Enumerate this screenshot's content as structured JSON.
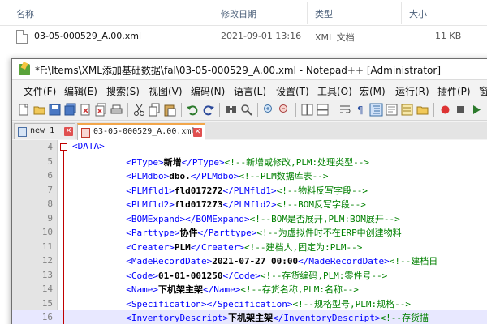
{
  "explorer": {
    "columns": [
      "名称",
      "修改日期",
      "类型",
      "大小"
    ],
    "file": {
      "name": "03-05-000529_A.00.xml",
      "modified": "2021-09-01 13:16",
      "type": "XML 文档",
      "size": "11 KB"
    }
  },
  "window": {
    "title": "*F:\\Items\\XML添加基础数据\\fal\\03-05-000529_A.00.xml - Notepad++ [Administrator]",
    "menu": [
      "文件(F)",
      "编辑(E)",
      "搜索(S)",
      "视图(V)",
      "编码(N)",
      "语言(L)",
      "设置(T)",
      "工具(O)",
      "宏(M)",
      "运行(R)",
      "插件(P)",
      "窗"
    ]
  },
  "tabs": [
    {
      "label": "new 1",
      "active": false
    },
    {
      "label": "03-05-000529_A.00.xml",
      "active": true
    }
  ],
  "editor": {
    "lines": [
      {
        "num": "4",
        "parts": [
          [
            "tag",
            "<DATA>"
          ]
        ]
      },
      {
        "num": "5",
        "parts": [
          [
            "tag",
            "<PType>"
          ],
          [
            "txt",
            "新增"
          ],
          [
            "tag",
            "</PType>"
          ],
          [
            "cmt",
            "<!--新增或修改,PLM:处理类型-->"
          ]
        ]
      },
      {
        "num": "6",
        "parts": [
          [
            "tag",
            "<PLMdbo>"
          ],
          [
            "txt",
            "dbo."
          ],
          [
            "tag",
            "</PLMdbo>"
          ],
          [
            "cmt",
            "<!--PLM数据库表-->"
          ]
        ]
      },
      {
        "num": "7",
        "parts": [
          [
            "tag",
            "<PLMfld1>"
          ],
          [
            "txt",
            "fld017272"
          ],
          [
            "tag",
            "</PLMfld1>"
          ],
          [
            "cmt",
            "<!--物料反写字段-->"
          ]
        ]
      },
      {
        "num": "8",
        "parts": [
          [
            "tag",
            "<PLMfld2>"
          ],
          [
            "txt",
            "fld017273"
          ],
          [
            "tag",
            "</PLMfld2>"
          ],
          [
            "cmt",
            "<!--BOM反写字段-->"
          ]
        ]
      },
      {
        "num": "9",
        "parts": [
          [
            "tag",
            "<BOMExpand>"
          ],
          [
            "tag",
            "</BOMExpand>"
          ],
          [
            "cmt",
            "<!--BOM是否展开,PLM:BOM展开-->"
          ]
        ]
      },
      {
        "num": "10",
        "parts": [
          [
            "tag",
            "<Parttype>"
          ],
          [
            "txt",
            "协件"
          ],
          [
            "tag",
            "</Parttype>"
          ],
          [
            "cmt",
            "<!--为虚拟件时不在ERP中创建物料"
          ]
        ]
      },
      {
        "num": "11",
        "parts": [
          [
            "tag",
            "<Creater>"
          ],
          [
            "txt",
            "PLM"
          ],
          [
            "tag",
            "</Creater>"
          ],
          [
            "cmt",
            "<!--建档人,固定为:PLM-->"
          ]
        ]
      },
      {
        "num": "12",
        "parts": [
          [
            "tag",
            "<MadeRecordDate>"
          ],
          [
            "txt",
            "2021-07-27 00:00"
          ],
          [
            "tag",
            "</MadeRecordDate>"
          ],
          [
            "cmt",
            "<!--建档日"
          ]
        ]
      },
      {
        "num": "13",
        "parts": [
          [
            "tag",
            "<Code>"
          ],
          [
            "txt",
            "01-01-001250"
          ],
          [
            "tag",
            "</Code>"
          ],
          [
            "cmt",
            "<!--存货编码,PLM:零件号-->"
          ]
        ]
      },
      {
        "num": "14",
        "parts": [
          [
            "tag",
            "<Name>"
          ],
          [
            "txt",
            "下机架主架"
          ],
          [
            "tag",
            "</Name>"
          ],
          [
            "cmt",
            "<!--存货名称,PLM:名称-->"
          ]
        ]
      },
      {
        "num": "15",
        "parts": [
          [
            "tag",
            "<Specification>"
          ],
          [
            "tag",
            "</Specification>"
          ],
          [
            "cmt",
            "<!--规格型号,PLM:规格-->"
          ]
        ]
      },
      {
        "num": "16",
        "parts": [
          [
            "tag",
            "<InventoryDescript>"
          ],
          [
            "txt",
            "下机架主架"
          ],
          [
            "tag",
            "</InventoryDescript>"
          ],
          [
            "cmt",
            "<!--存货描"
          ]
        ]
      }
    ]
  }
}
